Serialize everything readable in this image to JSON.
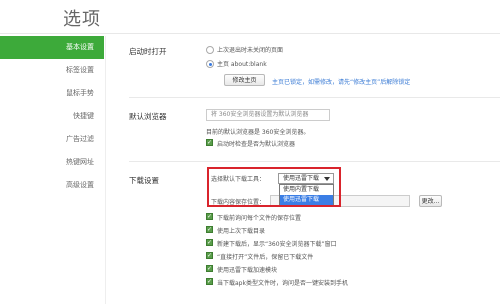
{
  "title": "选项",
  "sidebar": {
    "items": [
      {
        "label": "基本设置"
      },
      {
        "label": "标签设置"
      },
      {
        "label": "鼠标手势"
      },
      {
        "label": "快捷键"
      },
      {
        "label": "广告过滤"
      },
      {
        "label": "热键网址"
      },
      {
        "label": "高级设置"
      }
    ]
  },
  "startup": {
    "label": "启动时打开",
    "option1": "上次退出时未关闭的页面",
    "option2": "主页  about:blank",
    "modify_button": "修改主页",
    "hint": "主页已锁定，如需修改，请先“修改主页”后解除锁定"
  },
  "default_browser": {
    "label": "默认浏览器",
    "set_button": "将 360安全浏览器设置为默认浏览器",
    "status": "目前的默认浏览器是 360安全浏览器。",
    "check_label": "启动时检查是否为默认浏览器"
  },
  "download": {
    "label": "下载设置",
    "tool_label": "选择默认下载工具：",
    "tool_selected": "使用迅雷下载",
    "tool_options": [
      "使用内置下载",
      "使用迅雷下载"
    ],
    "path_label": "下载内容保存位置：",
    "change_button": "更改...",
    "options": [
      "下载前询问每个文件的保存位置",
      "使用上次下载目录",
      "新建下载后，显示“360安全浏览器下载”窗口",
      "“直接打开”文件后，保留已下载文件",
      "使用迅雷下载加速模块",
      "当下载apk类型文件时，询问是否一键安装到手机"
    ]
  },
  "colors": {
    "accent": "#3daa3a",
    "highlight": "#d9242c",
    "selection": "#3b7ee5"
  }
}
